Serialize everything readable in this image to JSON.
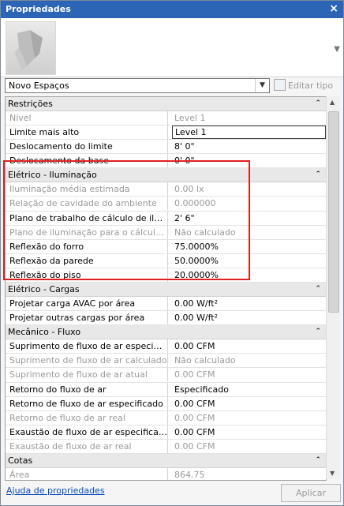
{
  "window": {
    "title": "Propriedades",
    "close_glyph": "×"
  },
  "type_selector": {
    "value": "Novo Espaços",
    "edit_type_label": "Editar tipo"
  },
  "groups": [
    {
      "label": "Restrições",
      "rows": [
        {
          "k": "Nível",
          "v": "Level 1",
          "disabled": true
        },
        {
          "k": "Limite mais alto",
          "v": "Level 1",
          "editing": true
        },
        {
          "k": "Deslocamento do limite",
          "v": "8'  0\""
        },
        {
          "k": "Deslocamento da base",
          "v": "0'  0\""
        }
      ]
    },
    {
      "label": "Elétrico - Iluminação",
      "rows": [
        {
          "k": "Iluminação média estimada",
          "v": "0.00 lx",
          "disabled": true
        },
        {
          "k": "Relação de cavidade do ambiente",
          "v": "0.000000",
          "disabled": true
        },
        {
          "k": "Plano de trabalho de cálculo de ilum...",
          "v": "2'  6\""
        },
        {
          "k": "Plano de iluminação para o cálculo ...",
          "v": "Não calculado",
          "disabled": true
        },
        {
          "k": "Reflexão do forro",
          "v": "75.0000%"
        },
        {
          "k": "Reflexão da parede",
          "v": "50.0000%"
        },
        {
          "k": "Reflexão do piso",
          "v": "20.0000%"
        }
      ]
    },
    {
      "label": "Elétrico - Cargas",
      "rows": [
        {
          "k": "Projetar carga AVAC por área",
          "v": "0.00 W/ft²"
        },
        {
          "k": "Projetar outras cargas por área",
          "v": "0.00 W/ft²"
        }
      ]
    },
    {
      "label": "Mecânico - Fluxo",
      "rows": [
        {
          "k": "Suprimento de fluxo de ar especifica...",
          "v": "0.00 CFM"
        },
        {
          "k": "Suprimento de fluxo de ar calculado",
          "v": "Não calculado",
          "disabled": true
        },
        {
          "k": "Suprimento de fluxo de ar atual",
          "v": "0.00 CFM",
          "disabled": true
        },
        {
          "k": "Retorno do fluxo de ar",
          "v": "Especificado"
        },
        {
          "k": "Retorno de fluxo de ar especificado",
          "v": "0.00 CFM"
        },
        {
          "k": "Retorno de fluxo de ar real",
          "v": "0.00 CFM",
          "disabled": true
        },
        {
          "k": "Exaustão de fluxo de ar especificado",
          "v": "0.00 CFM"
        },
        {
          "k": "Exaustão de fluxo de ar real",
          "v": "0.00 CFM",
          "disabled": true
        }
      ]
    },
    {
      "label": "Cotas",
      "rows": [
        {
          "k": "Área",
          "v": "864.75",
          "disabled": true
        }
      ]
    }
  ],
  "footer": {
    "help_link": "Ajuda de propriedades",
    "apply_label": "Aplicar"
  },
  "colors": {
    "titlebar": "#2c64b6",
    "highlight_box": "#e02020",
    "link": "#0a4bbf"
  },
  "icons": {
    "collapse": "⌃",
    "dropdown": "▼"
  }
}
